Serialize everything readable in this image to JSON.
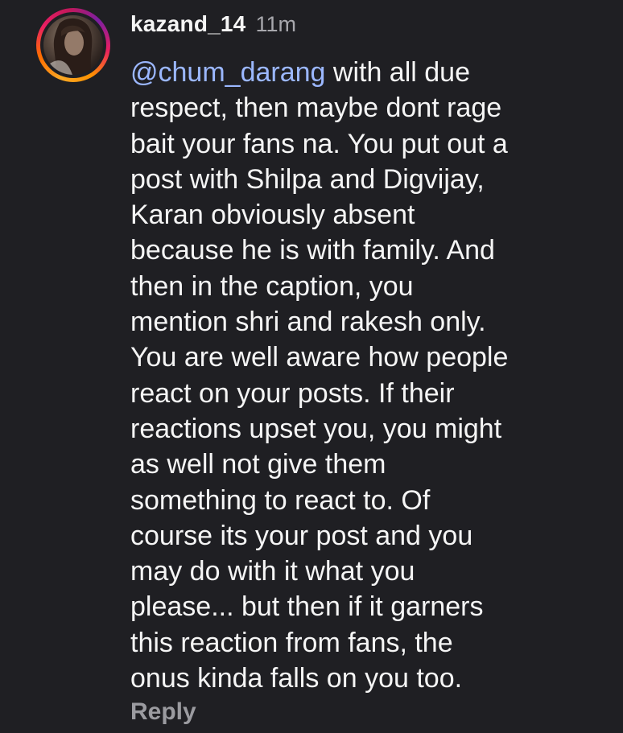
{
  "comment": {
    "username": "kazand_14",
    "timestamp": "11m",
    "mention": "@chum_darang",
    "text": " with all due\nrespect, then maybe dont rage\nbait your fans na. You put out a\npost with Shilpa and Digvijay,\nKaran obviously absent\nbecause he is with family. And\nthen in the caption, you\nmention shri and rakesh only.\nYou are well aware how people\nreact on your posts. If their\nreactions upset you, you might\nas well not give them\nsomething to react to. Of\ncourse its your post and you\nmay do with it what you\nplease... but then if it garners\nthis reaction from fans, the\nonus kinda falls on you too.",
    "reply_label": "Reply"
  },
  "colors": {
    "background": "#1f1f23",
    "text": "#f5f5f5",
    "secondary": "#a8a8ad",
    "mention": "#9bb7ff"
  }
}
